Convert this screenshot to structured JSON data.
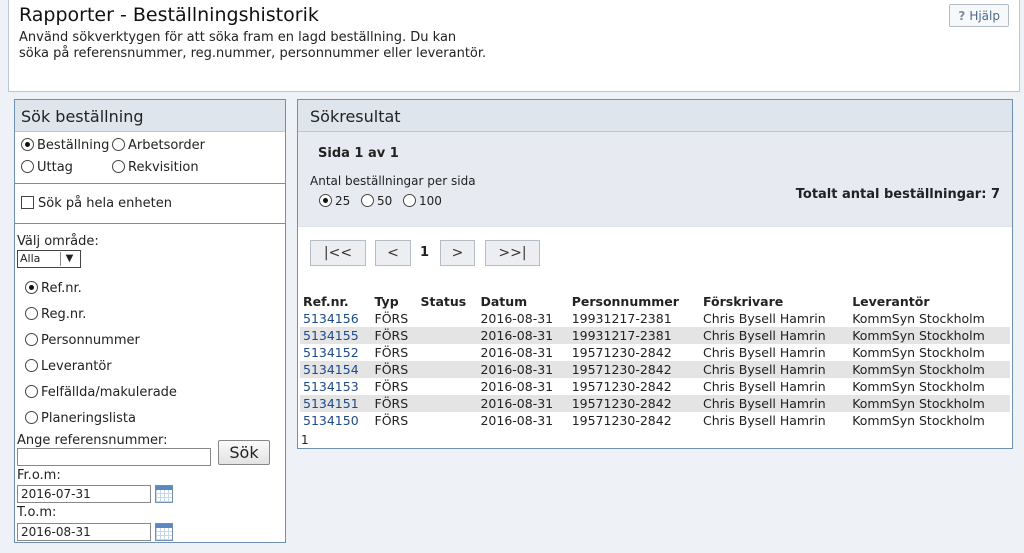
{
  "header": {
    "title": "Rapporter - Beställningshistorik",
    "description_line1": "Använd sökverktygen för att söka fram en lagd beställning. Du kan",
    "description_line2": "söka på referensnummer, reg.nummer, personnummer eller leverantör.",
    "help_label": "Hjälp",
    "help_icon": "question-icon"
  },
  "search": {
    "title": "Sök beställning",
    "types": [
      {
        "label": "Beställning",
        "checked": true
      },
      {
        "label": "Arbetsorder",
        "checked": false
      },
      {
        "label": "Uttag",
        "checked": false
      },
      {
        "label": "Rekvisition",
        "checked": false
      }
    ],
    "whole_unit_label": "Sök på hela enheten",
    "area_label": "Välj område:",
    "area_value": "Alla",
    "search_by": [
      {
        "label": "Ref.nr.",
        "checked": true
      },
      {
        "label": "Reg.nr.",
        "checked": false
      },
      {
        "label": "Personnummer",
        "checked": false
      },
      {
        "label": "Leverantör",
        "checked": false
      },
      {
        "label": "Felfällda/makulerade",
        "checked": false
      },
      {
        "label": "Planeringslista",
        "checked": false
      }
    ],
    "ref_label": "Ange referensnummer:",
    "ref_value": "",
    "search_button": "Sök",
    "from_label": "Fr.o.m:",
    "from_value": "2016-07-31",
    "to_label": "T.o.m:",
    "to_value": "2016-08-31"
  },
  "results": {
    "title": "Sökresultat",
    "page_info": "Sida 1 av 1",
    "per_page_label": "Antal beställningar per sida",
    "per_page_options": [
      {
        "label": "25",
        "checked": true
      },
      {
        "label": "50",
        "checked": false
      },
      {
        "label": "100",
        "checked": false
      }
    ],
    "total": "Totalt antal beställningar: 7",
    "pager": {
      "first": "|<<",
      "prev": "<",
      "current": "1",
      "next": ">",
      "last": ">>|"
    },
    "columns": [
      "Ref.nr.",
      "Typ",
      "Status",
      "Datum",
      "Personnummer",
      "Förskrivare",
      "Leverantör"
    ],
    "rows": [
      [
        "5134156",
        "FÖRS",
        "",
        "2016-08-31",
        "19931217-2381",
        "Chris Bysell Hamrin",
        "KommSyn Stockholm"
      ],
      [
        "5134155",
        "FÖRS",
        "",
        "2016-08-31",
        "19931217-2381",
        "Chris Bysell Hamrin",
        "KommSyn Stockholm"
      ],
      [
        "5134152",
        "FÖRS",
        "",
        "2016-08-31",
        "19571230-2842",
        "Chris Bysell Hamrin",
        "KommSyn Stockholm"
      ],
      [
        "5134154",
        "FÖRS",
        "",
        "2016-08-31",
        "19571230-2842",
        "Chris Bysell Hamrin",
        "KommSyn Stockholm"
      ],
      [
        "5134153",
        "FÖRS",
        "",
        "2016-08-31",
        "19571230-2842",
        "Chris Bysell Hamrin",
        "KommSyn Stockholm"
      ],
      [
        "5134151",
        "FÖRS",
        "",
        "2016-08-31",
        "19571230-2842",
        "Chris Bysell Hamrin",
        "KommSyn Stockholm"
      ],
      [
        "5134150",
        "FÖRS",
        "",
        "2016-08-31",
        "19571230-2842",
        "Chris Bysell Hamrin",
        "KommSyn Stockholm"
      ]
    ],
    "pages_footer": "1"
  },
  "colors": {
    "link": "#1c4a8c",
    "panel_border": "#6f8fb3",
    "header_bg": "#dfe5ec",
    "alt_row": "#e4e4e4"
  }
}
